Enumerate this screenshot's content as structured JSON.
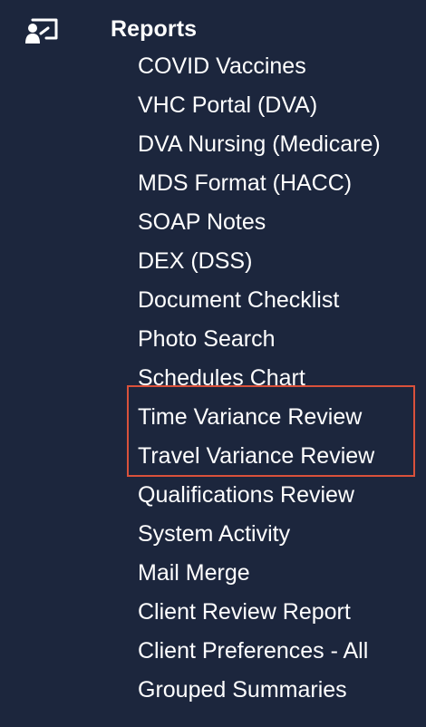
{
  "header": {
    "title": "Reports",
    "icon": "presentation-user-icon"
  },
  "menu": {
    "items": [
      {
        "label": "COVID Vaccines"
      },
      {
        "label": "VHC Portal (DVA)"
      },
      {
        "label": "DVA Nursing (Medicare)"
      },
      {
        "label": "MDS Format (HACC)"
      },
      {
        "label": "SOAP Notes"
      },
      {
        "label": "DEX (DSS)"
      },
      {
        "label": "Document Checklist"
      },
      {
        "label": "Photo Search"
      },
      {
        "label": "Schedules Chart"
      },
      {
        "label": "Time Variance Review"
      },
      {
        "label": "Travel Variance Review"
      },
      {
        "label": "Qualifications Review"
      },
      {
        "label": "System Activity"
      },
      {
        "label": "Mail Merge"
      },
      {
        "label": "Client Review Report"
      },
      {
        "label": "Client Preferences - All"
      },
      {
        "label": "Grouped Summaries"
      }
    ]
  },
  "colors": {
    "background": "#1c263d",
    "text": "#ffffff",
    "highlight_border": "#d9513b"
  }
}
